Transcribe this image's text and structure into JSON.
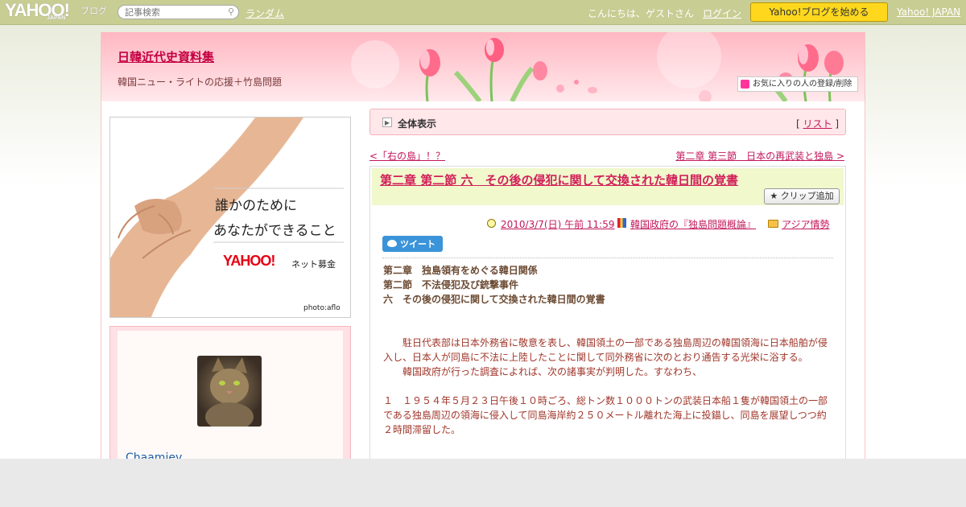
{
  "topbar": {
    "logo": "YAHOO!",
    "logo_japan": "JAPAN",
    "logo_sub": "ブログ",
    "search_placeholder": "記事検索",
    "random": "ランダム",
    "greeting": "こんにちは、ゲストさん",
    "login": "ログイン",
    "start_blog": "Yahoo!ブログを始める",
    "yahoo_japan": "Yahoo! JAPAN"
  },
  "header": {
    "title": "日韓近代史資料集",
    "subtitle": "韓国ニュー・ライトの応援＋竹島問題",
    "fav_button": "お気に入りの人の登録/削除"
  },
  "banner": {
    "line1": "誰かのために",
    "line2": "あなたができること",
    "yahoo": "YAHOO!",
    "netbokin": "ネット募金",
    "photo_credit": "photo:aflo"
  },
  "profile": {
    "username": "Chaamiev"
  },
  "breadcrumb": {
    "label": "全体表示",
    "list_left": "[",
    "list_link": "リスト",
    "list_right": "]"
  },
  "pager": {
    "prev": "<「右の島」！？",
    "next": "第二章 第三節　日本の再武装と独島 >"
  },
  "article": {
    "title": "第二章 第二節 六　その後の侵犯に関して交換された韓日間の覚書",
    "clip_button": "クリップ追加",
    "date": "2010/3/7(日) 午前 11:59",
    "category1": "韓国政府の『独島問題概論』",
    "category2": "アジア情勢",
    "tweet": "ツイート",
    "heading1": "第二章　独島領有をめぐる韓日関係",
    "heading2": "第二節　不法侵犯及び銃撃事件",
    "heading3": "六　その後の侵犯に関して交換された韓日間の覚書",
    "para1": "駐日代表部は日本外務省に敬意を表し、韓国領土の一部である独島周辺の韓国領海に日本船舶が侵入し、日本人が同島に不法に上陸したことに関して同外務省に次のとおり通告する光栄に浴する。",
    "para2": "韓国政府が行った調査によれば、次の諸事実が判明した。すなわち、",
    "para3": "１　１９５４年５月２３日午後１０時ごろ、総トン数１０００トンの武装日本船１隻が韓国領土の一部である独島周辺の領海に侵入して同島海岸約２５０メートル離れた海上に投錨し、同島を展望しつつ約２時間滞留した。"
  },
  "colors": {
    "topbar": "#c8cd94",
    "accent_pink": "#c2185b",
    "title_red": "#d21f5a",
    "start_button": "#ffd81e",
    "tweet_blue": "#3b94d9"
  }
}
